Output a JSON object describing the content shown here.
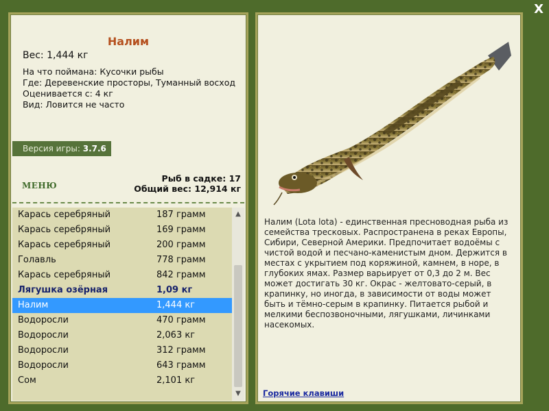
{
  "window": {
    "close_label": "X"
  },
  "fish": {
    "name": "Налим",
    "weight_line": "Вес: 1,444 кг",
    "caught_with": "На что поймана: Кусочки рыбы",
    "location": "Где: Деревенские просторы, Туманный восход",
    "valued_from": "Оценивается с: 4 кг",
    "rarity": "Вид: Ловится не часто"
  },
  "version": {
    "label": "Версия игры:",
    "value": "3.7.6"
  },
  "menu": {
    "label": "МЕНЮ"
  },
  "stats": {
    "fish_in_keepnet": "Рыб в садке: 17",
    "total_weight": "Общий вес: 12,914 кг"
  },
  "catch_list": [
    {
      "name": "Карась серебряный",
      "weight": "187 грамм"
    },
    {
      "name": "Карась серебряный",
      "weight": "169 грамм"
    },
    {
      "name": "Карась серебряный",
      "weight": "200 грамм"
    },
    {
      "name": "Голавль",
      "weight": "778 грамм"
    },
    {
      "name": "Карась серебряный",
      "weight": "842 грамм"
    },
    {
      "name": "Лягушка озёрная",
      "weight": "1,09 кг"
    },
    {
      "name": "Налим",
      "weight": "1,444 кг"
    },
    {
      "name": "Водоросли",
      "weight": "470 грамм"
    },
    {
      "name": "Водоросли",
      "weight": "2,063 кг"
    },
    {
      "name": "Водоросли",
      "weight": "312 грамм"
    },
    {
      "name": "Водоросли",
      "weight": "643 грамм"
    },
    {
      "name": "Сом",
      "weight": "2,101 кг"
    }
  ],
  "description": "Налим (Lota lota) - единственная пресноводная рыба из семейства тресковых. Распространена в реках Европы, Сибири, Северной Америки. Предпочитает водоёмы с чистой водой и песчано-каменистым дном. Держится в местах с укрытием под коряжиной, камнем, в норе, в глубоких ямах. Размер варьирует от 0,3 до 2 м. Вес может достигать 30 кг. Окрас - желтовато-серый, в крапинку, но иногда, в зависимости от воды может быть и тёмно-серым в крапинку. Питается рыбой и мелкими беспозвоночными, лягушками, личинками насекомых.",
  "hotkeys": {
    "label": "Горячие клавиши"
  },
  "icons": {
    "close": "close-icon",
    "scroll_up": "chevron-up-icon",
    "scroll_down": "chevron-down-icon"
  },
  "colors": {
    "background": "#4e6b2b",
    "panel": "#f1f0df",
    "title": "#b5501e",
    "selected_row": "#3399ff",
    "bold_row": "#17226b",
    "link": "#1a2aa0"
  }
}
